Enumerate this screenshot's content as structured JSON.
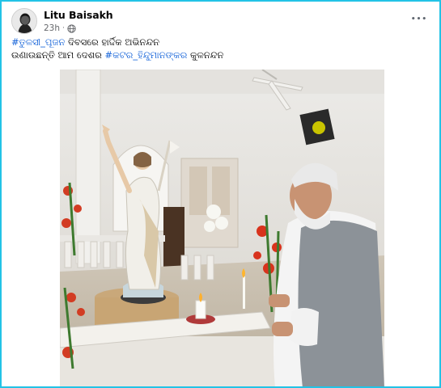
{
  "post": {
    "author": "Litu Baisakh",
    "time": "23h",
    "separator": "·",
    "privacy_icon": "globe-icon",
    "more_icon": "more-options-icon",
    "more_label": "•••",
    "caption": {
      "line1_hashtag": "#ତୁଳସୀ_ପୂଜନ",
      "line1_text": " ଦିବସରେ ହାର୍ଦ୍ଦିକ ଅଭିନନ୍ଦନ",
      "line2_text": "ଉଣାଉଛନ୍ତି ଆମ ଦେଶର ",
      "line2_hashtag": "#କଟର_ହିନ୍ଦୁମାନଙ୍କର",
      "line2_tail": " କୁଳନନ୍ଦନ"
    },
    "photo_description_icon": "post-photo"
  },
  "colors": {
    "frame_border": "#22c3e6",
    "hashtag": "#1664d9",
    "meta_text": "#65676b"
  }
}
